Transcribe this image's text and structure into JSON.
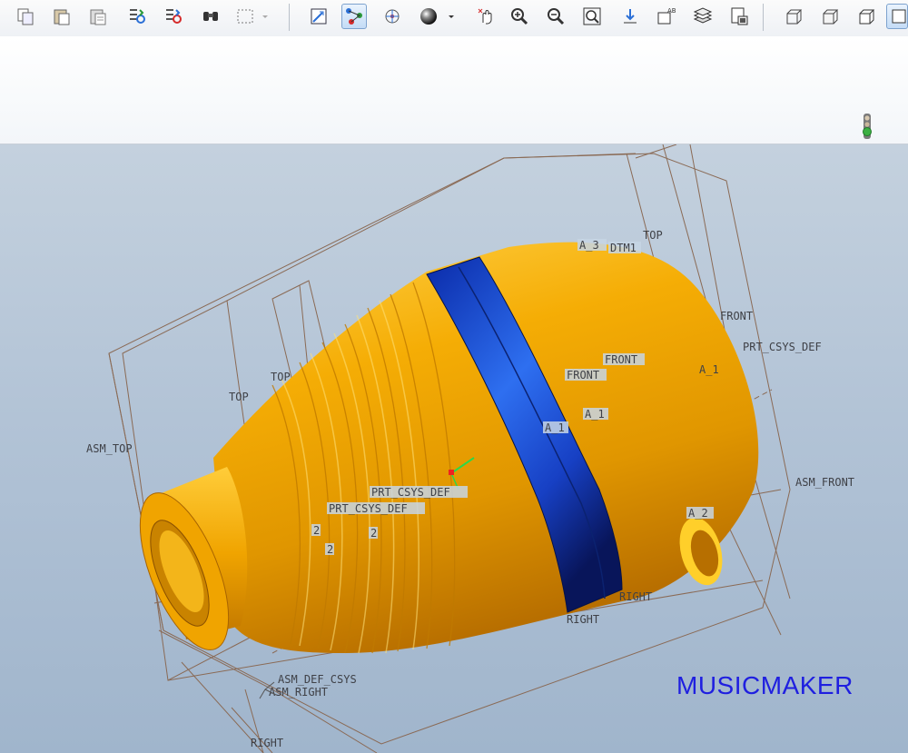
{
  "toolbar": {
    "icons": [
      "copy-icon",
      "paste-icon",
      "paste-special-icon",
      "regenerate-icon",
      "regenerate-manager-icon",
      "find-icon",
      "select-box-icon",
      "saved-views-icon",
      "datum-display-icon",
      "spin-center-icon",
      "shading-sphere-icon",
      "pan-zoom-icon",
      "zoom-in-icon",
      "zoom-out-icon",
      "refit-icon",
      "reorient-icon",
      "annotation-display-icon",
      "layers-icon",
      "view-manager-icon",
      "wireframe-icon",
      "hidden-line-icon",
      "no-hidden-icon",
      "shaded-icon"
    ]
  },
  "infobar": {
    "status_icon": "traffic-light-icon",
    "status_color": "#3cb043"
  },
  "model": {
    "body_color": "#f2a800",
    "band_color": "#1236c8",
    "frame_color": "#8a6a55"
  },
  "labels": {
    "a3": "A_3",
    "dtm1": "DTM1",
    "top1": "TOP",
    "top2": "TOP",
    "top3": "TOP",
    "front1": "FRONT",
    "front2": "FRONT",
    "front3": "FRONT",
    "prt_csys_def_right": "PRT_CSYS_DEF",
    "a1a": "A_1",
    "a1b": "A_1",
    "a1c": "A_1",
    "asm_top": "ASM_TOP",
    "asm_front": "ASM_FRONT",
    "prt_csys_def_center": "PRT_CSYS_DEF",
    "prt_csys_def_left": "PRT_CSYS_DEF",
    "a2": "A_2",
    "num2a": "2",
    "num2b": "2",
    "num2c": "2",
    "right1": "RIGHT",
    "right2": "RIGHT",
    "right3": "RIGHT",
    "asm_def_csys": "ASM_DEF_CSYS",
    "asm_right": "ASM_RIGHT"
  },
  "watermark": "MUSICMAKER"
}
